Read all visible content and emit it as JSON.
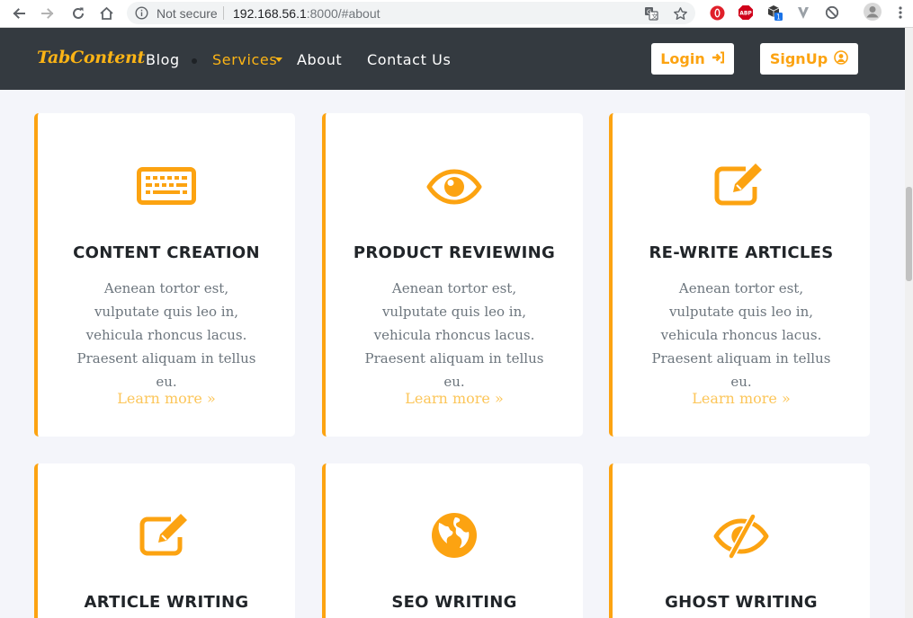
{
  "browser": {
    "security_label": "Not secure",
    "url_host": "192.168.56.1",
    "url_rest": ":8000/#about",
    "icons": [
      "back-icon",
      "forward-icon",
      "reload-icon",
      "home-icon",
      "info-icon",
      "translate-icon",
      "star-icon",
      "opera-icon",
      "adblock-icon",
      "extension-icon",
      "vpn-icon",
      "block-icon",
      "profile-icon",
      "menu-icon"
    ],
    "extension_badge": "1",
    "adblock_label": "ABP"
  },
  "header": {
    "brand": "TabContent",
    "nav": {
      "blog": "Blog",
      "services": "Services",
      "about": "About",
      "contact": "Contact Us"
    },
    "login_label": "Login",
    "signup_label": "SignUp"
  },
  "colors": {
    "accent": "#fca311",
    "header_bg": "#343a40",
    "page_bg": "#f4f5fa"
  },
  "services": [
    {
      "icon": "keyboard-icon",
      "title": "CONTENT CREATION",
      "text": "Aenean tortor est, vulputate quis leo in, vehicula rhoncus lacus. Praesent aliquam in tellus eu.",
      "link": "Learn more »"
    },
    {
      "icon": "eye-icon",
      "title": "PRODUCT REVIEWING",
      "text": "Aenean tortor est, vulputate quis leo in, vehicula rhoncus lacus. Praesent aliquam in tellus eu.",
      "link": "Learn more »"
    },
    {
      "icon": "edit-icon",
      "title": "RE-WRITE ARTICLES",
      "text": "Aenean tortor est, vulputate quis leo in, vehicula rhoncus lacus. Praesent aliquam in tellus eu.",
      "link": "Learn more »"
    },
    {
      "icon": "edit-icon",
      "title": "ARTICLE WRITING"
    },
    {
      "icon": "globe-icon",
      "title": "SEO WRITING"
    },
    {
      "icon": "eye-slash-icon",
      "title": "GHOST WRITING"
    }
  ]
}
